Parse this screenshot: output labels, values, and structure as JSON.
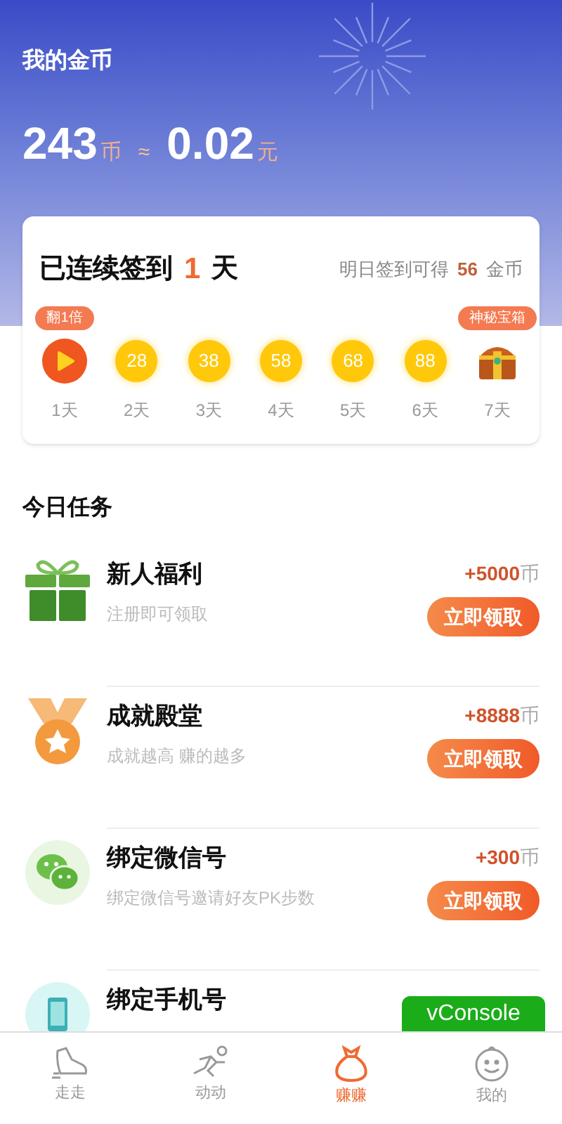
{
  "header": {
    "title": "我的金币",
    "coins": "243",
    "coin_unit": "币",
    "approx": "≈",
    "money": "0.02",
    "money_unit": "元"
  },
  "checkin": {
    "title": "已连续签到",
    "days": "1",
    "days_unit": "天",
    "tomorrow_prefix": "明日签到可得",
    "tomorrow_coins": "56",
    "tomorrow_suffix": "金币",
    "days_list": [
      {
        "kind": "video",
        "badge": "翻1倍",
        "label": "1天"
      },
      {
        "kind": "coin",
        "value": "28",
        "label": "2天"
      },
      {
        "kind": "coin",
        "value": "38",
        "label": "3天"
      },
      {
        "kind": "coin",
        "value": "58",
        "label": "4天"
      },
      {
        "kind": "coin",
        "value": "68",
        "label": "5天"
      },
      {
        "kind": "coin",
        "value": "88",
        "label": "6天"
      },
      {
        "kind": "chest",
        "badge": "神秘宝箱",
        "label": "7天"
      }
    ]
  },
  "tasks": {
    "title": "今日任务",
    "items": [
      {
        "kind": "gift",
        "title": "新人福利",
        "subtitle": "注册即可领取",
        "reward": "+5000",
        "unit": "币",
        "button": "立即领取"
      },
      {
        "kind": "medal",
        "title": "成就殿堂",
        "subtitle": "成就越高 赚的越多",
        "reward": "+8888",
        "unit": "币",
        "button": "立即领取"
      },
      {
        "kind": "wechat",
        "title": "绑定微信号",
        "subtitle": "绑定微信号邀请好友PK步数",
        "reward": "+300",
        "unit": "币",
        "button": "立即领取"
      },
      {
        "kind": "phone",
        "title": "绑定手机号"
      }
    ]
  },
  "vconsole": "vConsole",
  "tab_bar": [
    {
      "kind": "shoe",
      "label": "走走",
      "selected": false
    },
    {
      "kind": "runner",
      "label": "动动",
      "selected": false
    },
    {
      "kind": "bag",
      "label": "赚赚",
      "selected": true
    },
    {
      "kind": "face",
      "label": "我的",
      "selected": false
    }
  ]
}
